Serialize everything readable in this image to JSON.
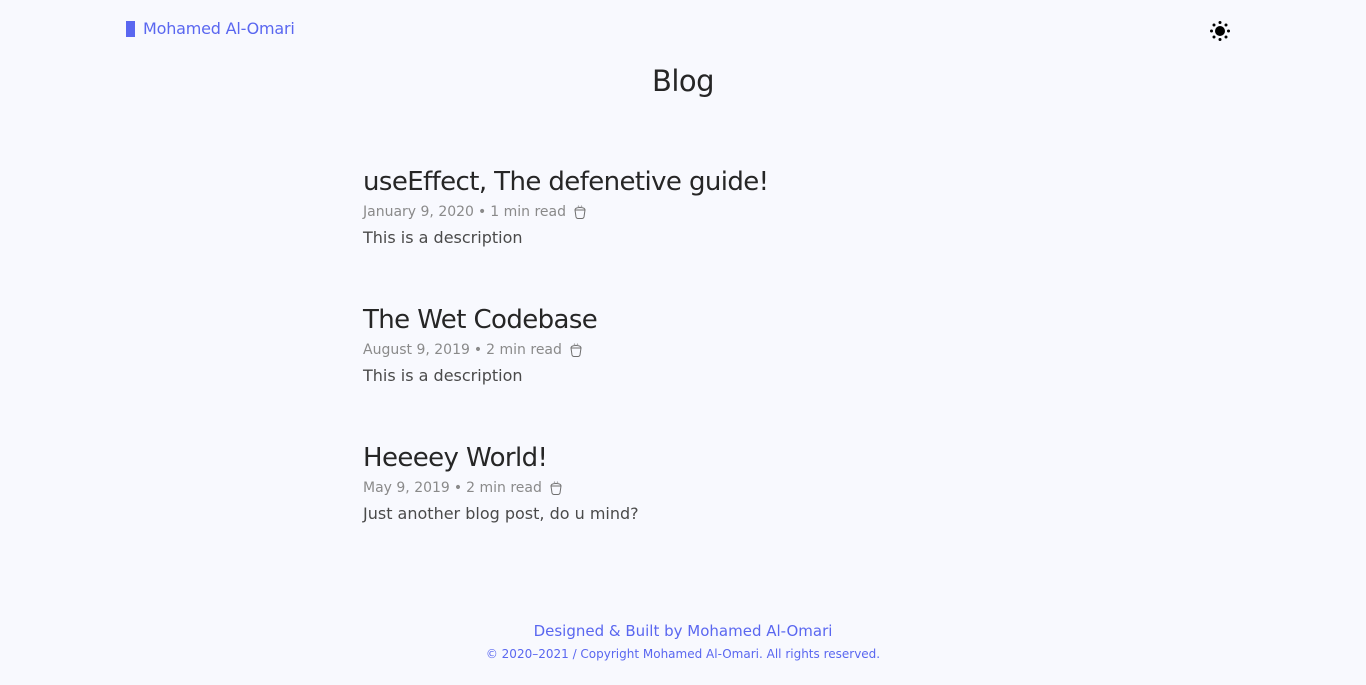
{
  "header": {
    "brand": "Mohamed Al-Omari",
    "theme_toggle_icon": "sun-icon"
  },
  "page": {
    "title": "Blog"
  },
  "posts": [
    {
      "title": "useEffect, The defenetive guide!",
      "date": "January 9, 2020",
      "read_time": "1 min read",
      "read_icon": "cup-icon",
      "description": "This is a description"
    },
    {
      "title": "The Wet Codebase",
      "date": "August 9, 2019",
      "read_time": "2 min read",
      "read_icon": "cup-icon",
      "description": "This is a description"
    },
    {
      "title": "Heeeey World!",
      "date": "May 9, 2019",
      "read_time": "2 min read",
      "read_icon": "cup-icon",
      "description": "Just another blog post, do u mind?"
    }
  ],
  "meta_separator": "•",
  "footer": {
    "credit": "Designed & Built by Mohamed Al-Omari",
    "copyright": "© 2020–2021 / Copyright Mohamed Al-Omari. All rights reserved."
  },
  "colors": {
    "accent": "#5a67f0",
    "background": "#f8f9fe",
    "text": "#262626",
    "muted": "#8a8a8a"
  }
}
